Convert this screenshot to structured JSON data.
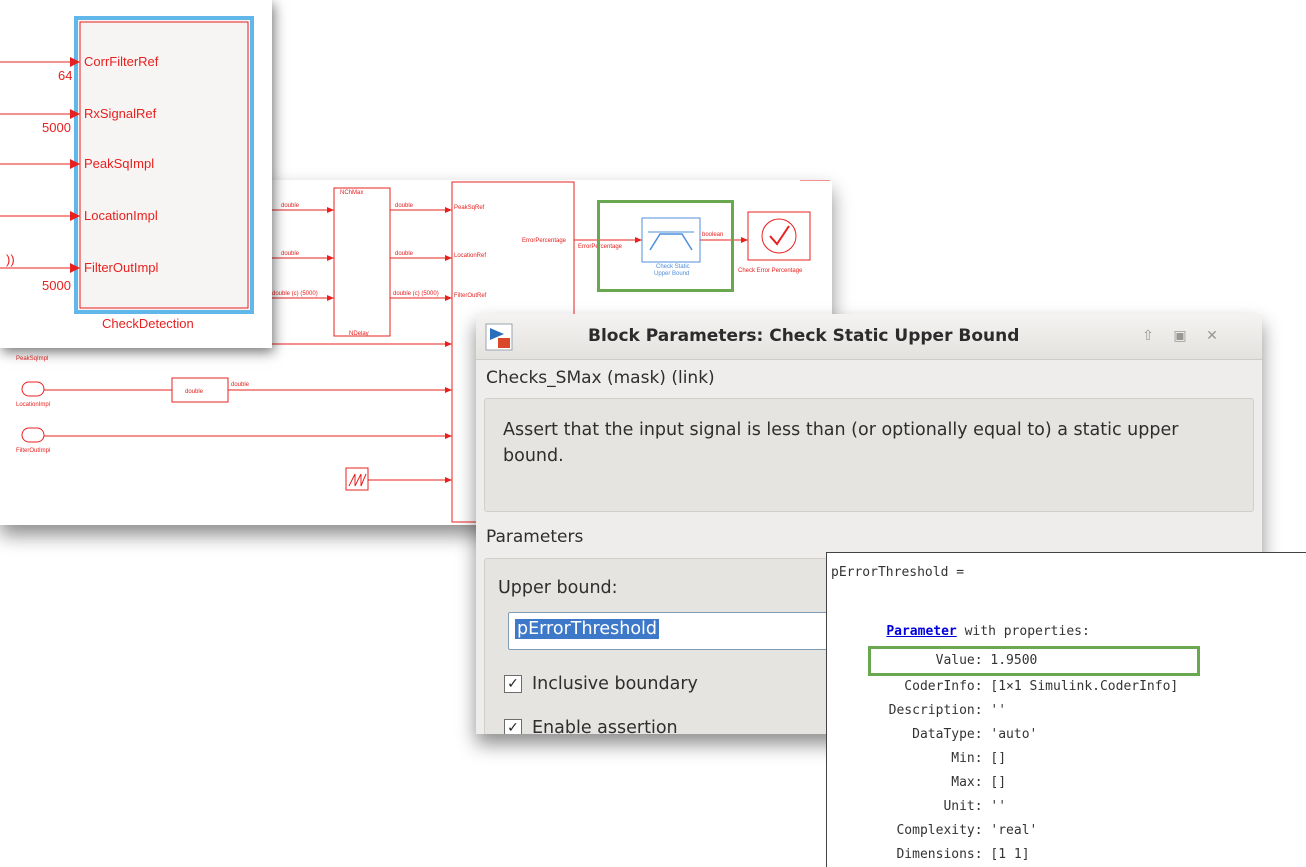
{
  "subsystem": {
    "name": "CheckDetection",
    "ports": [
      "CorrFilterRef",
      "RxSignalRef",
      "PeakSqImpl",
      "LocationImpl",
      "FilterOutImpl"
    ],
    "port_dims": [
      "64",
      "5000",
      "5000"
    ],
    "left_fragment": "))"
  },
  "model": {
    "source_labels": [
      "PeakSqImpl",
      "LocationImpl",
      "FilterOutImpl"
    ],
    "convert_block": "double",
    "delay_block": "NDelay",
    "delay_in_title": "NChMax",
    "error_signal": "ErrorPercentage",
    "check_block": "Check Static Upper Bound",
    "check_block_line1": "Check Static",
    "check_block_line2": "Upper Bound",
    "assert_block": "Check Error Percentage",
    "signal_labels": [
      "double",
      "double",
      "double (c) (5000)",
      "boolean"
    ],
    "target_ports": [
      "PeakSqRef",
      "LocationRef",
      "FilterOutRef"
    ]
  },
  "dialog": {
    "title": "Block Parameters: Check Static Upper Bound",
    "block_type": "Checks_SMax (mask) (link)",
    "description": "Assert that the input signal is less than (or optionally equal to) a static upper bound.",
    "params_header": "Parameters",
    "upper_bound_label": "Upper bound:",
    "upper_bound_value": "pErrorThreshold",
    "inclusive_label": "Inclusive boundary",
    "inclusive_checked": "✓",
    "enable_label": "Enable assertion"
  },
  "cmd": {
    "var_line": "pErrorThreshold =",
    "param_link": "Parameter",
    "with_props": " with properties:",
    "props": [
      "        Value: 1.9500",
      "    CoderInfo: [1×1 Simulink.CoderInfo]",
      "  Description: ''",
      "     DataType: 'auto'",
      "          Min: []",
      "          Max: []",
      "         Unit: ''",
      "   Complexity: 'real'",
      "   Dimensions: [1 1]"
    ]
  },
  "colors": {
    "signal_red": "#e8201e",
    "highlight_green": "#6aa84f",
    "selection_blue": "#3d78c9"
  }
}
